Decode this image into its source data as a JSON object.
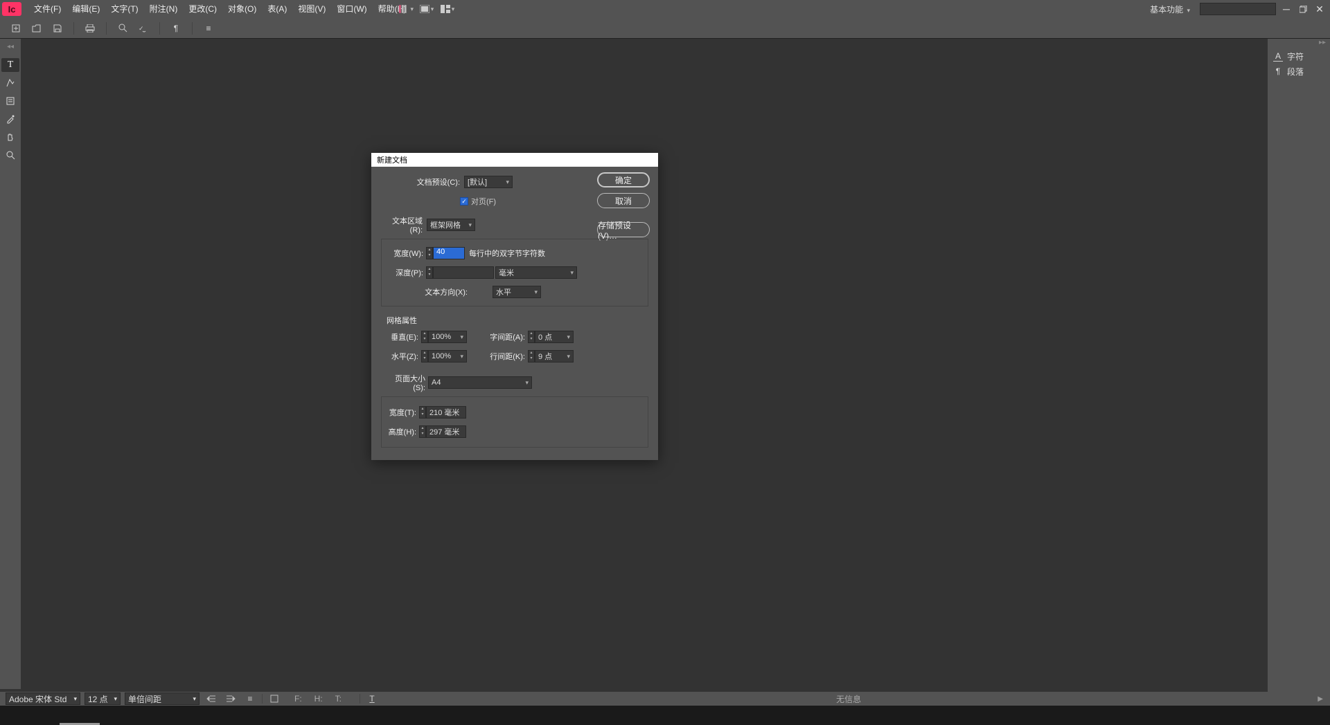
{
  "app": {
    "logo": "Ic"
  },
  "menubar": [
    "文件(F)",
    "编辑(E)",
    "文字(T)",
    "附注(N)",
    "更改(C)",
    "对象(O)",
    "表(A)",
    "视图(V)",
    "窗口(W)",
    "帮助(H)"
  ],
  "workspace": "基本功能",
  "right_panel": {
    "items": [
      {
        "icon": "A",
        "label": "字符"
      },
      {
        "icon": "¶",
        "label": "段落"
      }
    ]
  },
  "dialog": {
    "title": "新建文档",
    "buttons": {
      "ok": "确定",
      "cancel": "取消",
      "save_preset": "存储预设(V)…"
    },
    "preset_label": "文档预设(C):",
    "preset_value": "[默认]",
    "facing_pages": "对页(F)",
    "text_area_label": "文本区域(R):",
    "text_area_value": "框架网格",
    "width_label": "宽度(W):",
    "width_value": "40",
    "width_note": "每行中的双字节字符数",
    "depth_label": "深度(P):",
    "depth_value": "",
    "depth_unit": "毫米",
    "textdir_label": "文本方向(X):",
    "textdir_value": "水平",
    "grid_section": "网格属性",
    "vert_label": "垂直(E):",
    "vert_value": "100%",
    "charspace_label": "字间距(A):",
    "charspace_value": "0 点",
    "horiz_label": "水平(Z):",
    "horiz_value": "100%",
    "linespace_label": "行间距(K):",
    "linespace_value": "9 点",
    "pagesize_label": "页面大小(S):",
    "pagesize_value": "A4",
    "pwidth_label": "宽度(T):",
    "pwidth_value": "210 毫米",
    "pheight_label": "高度(H):",
    "pheight_value": "297 毫米"
  },
  "statusbar": {
    "font": "Adobe 宋体 Std",
    "size": "12 点",
    "leading": "单倍间距",
    "labels": {
      "f": "F:",
      "h": "H:",
      "t": "T:"
    },
    "info": "无信息"
  }
}
